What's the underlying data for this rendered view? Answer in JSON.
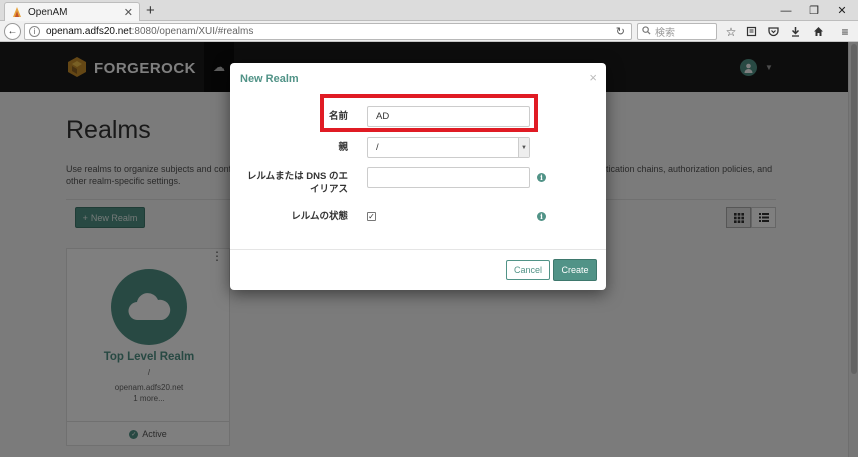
{
  "browser": {
    "tab_title": "OpenAM",
    "url_host": "openam.adfs20.net",
    "url_path": ":8080/openam/XUI/#realms",
    "search_placeholder": "検索"
  },
  "header": {
    "brand": "FORGEROCK"
  },
  "page": {
    "title": "Realms",
    "description_left": "Use realms to organize subjects and conf",
    "description_left_line2": "other realm-specific settings.",
    "description_right": "entication chains, authorization policies, and",
    "new_realm_button": "New Realm"
  },
  "realm_card": {
    "name": "Top Level Realm",
    "path": "/",
    "alias": "openam.adfs20.net",
    "more": "1 more...",
    "status": "Active"
  },
  "modal": {
    "title": "New Realm",
    "close": "×",
    "fields": {
      "name_label": "名前",
      "name_value": "AD",
      "parent_label": "親",
      "parent_value": "/",
      "alias_label_line1": "レルムまたは DNS のエ",
      "alias_label_line2": "イリアス",
      "alias_value": "",
      "status_label": "レルムの状態",
      "status_checked": true
    },
    "cancel_button": "Cancel",
    "create_button": "Create"
  },
  "colors": {
    "accent": "#519387",
    "highlight": "#e01b24",
    "header_bg": "#1b1b1b"
  }
}
